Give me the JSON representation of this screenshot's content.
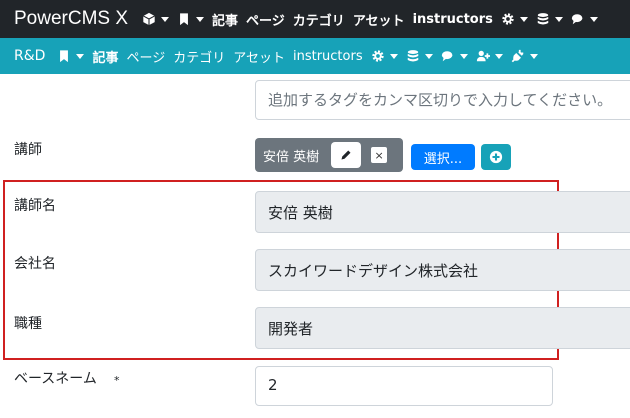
{
  "topbar": {
    "brand": "PowerCMS X",
    "items": [
      {
        "icon": "cube-icon",
        "label": ""
      },
      {
        "icon": "bookmark-icon",
        "label": ""
      },
      {
        "icon": "",
        "label": "記事"
      },
      {
        "icon": "",
        "label": "ページ"
      },
      {
        "icon": "",
        "label": "カテゴリ"
      },
      {
        "icon": "",
        "label": "アセット"
      },
      {
        "icon": "",
        "label": "instructors"
      },
      {
        "icon": "gear-icon",
        "label": ""
      },
      {
        "icon": "database-icon",
        "label": ""
      },
      {
        "icon": "comments-icon",
        "label": ""
      }
    ]
  },
  "subbar": {
    "site": "R&D",
    "items": [
      {
        "icon": "bookmark-icon",
        "label": ""
      },
      {
        "icon": "",
        "label": "記事"
      },
      {
        "icon": "",
        "label": "ページ"
      },
      {
        "icon": "",
        "label": "カテゴリ"
      },
      {
        "icon": "",
        "label": "アセット"
      },
      {
        "icon": "",
        "label": "instructors"
      },
      {
        "icon": "gear-icon",
        "label": ""
      },
      {
        "icon": "database-icon",
        "label": ""
      },
      {
        "icon": "comments-icon",
        "label": ""
      },
      {
        "icon": "user-plus-icon",
        "label": ""
      },
      {
        "icon": "plug-icon",
        "label": ""
      }
    ]
  },
  "form": {
    "tags_placeholder": "追加するタグをカンマ区切りで入力してください。",
    "instructor_label": "講師",
    "instructor_chip": "安倍 英樹",
    "remove_symbol": "×",
    "select_label": "選択...",
    "instructor_name_label": "講師名",
    "instructor_name_value": "安倍 英樹",
    "company_label": "会社名",
    "company_value": "スカイワードデザイン株式会社",
    "job_label": "職種",
    "job_value": "開発者",
    "basename_label": "ベースネーム",
    "required_mark": "*",
    "basename_value": "2"
  },
  "colors": {
    "topbar": "#212529",
    "subbar": "#17a2b8",
    "primary": "#007bff",
    "highlight": "#d02020",
    "chip": "#6c757d"
  }
}
